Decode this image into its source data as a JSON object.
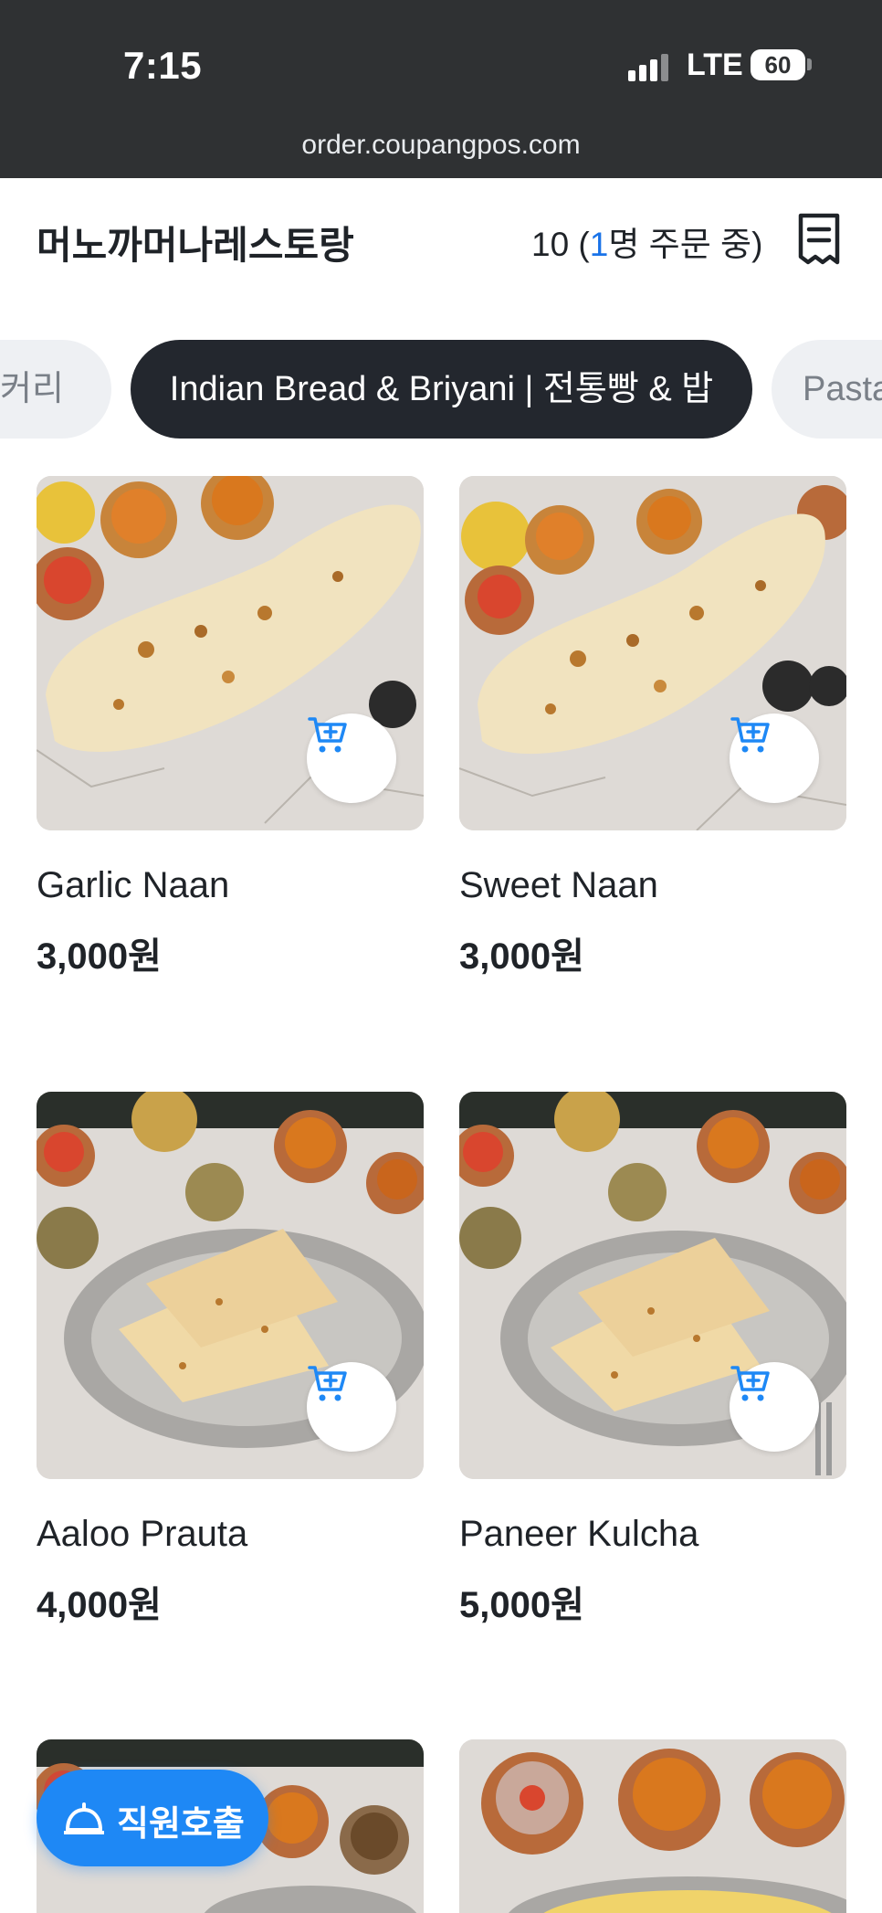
{
  "status_bar": {
    "time": "7:15",
    "network": "LTE",
    "battery": "60",
    "url": "order.coupangpos.com"
  },
  "header": {
    "store_name": "머노까머나레스토랑",
    "table_number": "10",
    "order_status_open": " (",
    "order_status_count": "1",
    "order_status_rest": "명 주문 중)",
    "receipt_icon": "receipt-icon"
  },
  "categories": {
    "prev_label": "커리",
    "active_label": "Indian Bread & Briyani | 전통빵 & 밥",
    "next_label": "Pasta"
  },
  "menu_items": [
    {
      "name": "Garlic Naan",
      "price": "3,000원",
      "image": "naan-plate"
    },
    {
      "name": "Sweet Naan",
      "price": "3,000원",
      "image": "naan-plate"
    },
    {
      "name": "Aaloo Prauta",
      "price": "4,000원",
      "image": "flatbread-platter"
    },
    {
      "name": "Paneer Kulcha",
      "price": "5,000원",
      "image": "flatbread-platter"
    },
    {
      "name": "",
      "price": "",
      "image": "flatbread-platter"
    },
    {
      "name": "",
      "price": "",
      "image": "biryani-bowls"
    }
  ],
  "fab": {
    "label": "직원호출",
    "icon": "service-bell-icon"
  },
  "colors": {
    "accent": "#1e88f5",
    "status_bar": "#2f3133",
    "active_tab": "#23272e"
  }
}
